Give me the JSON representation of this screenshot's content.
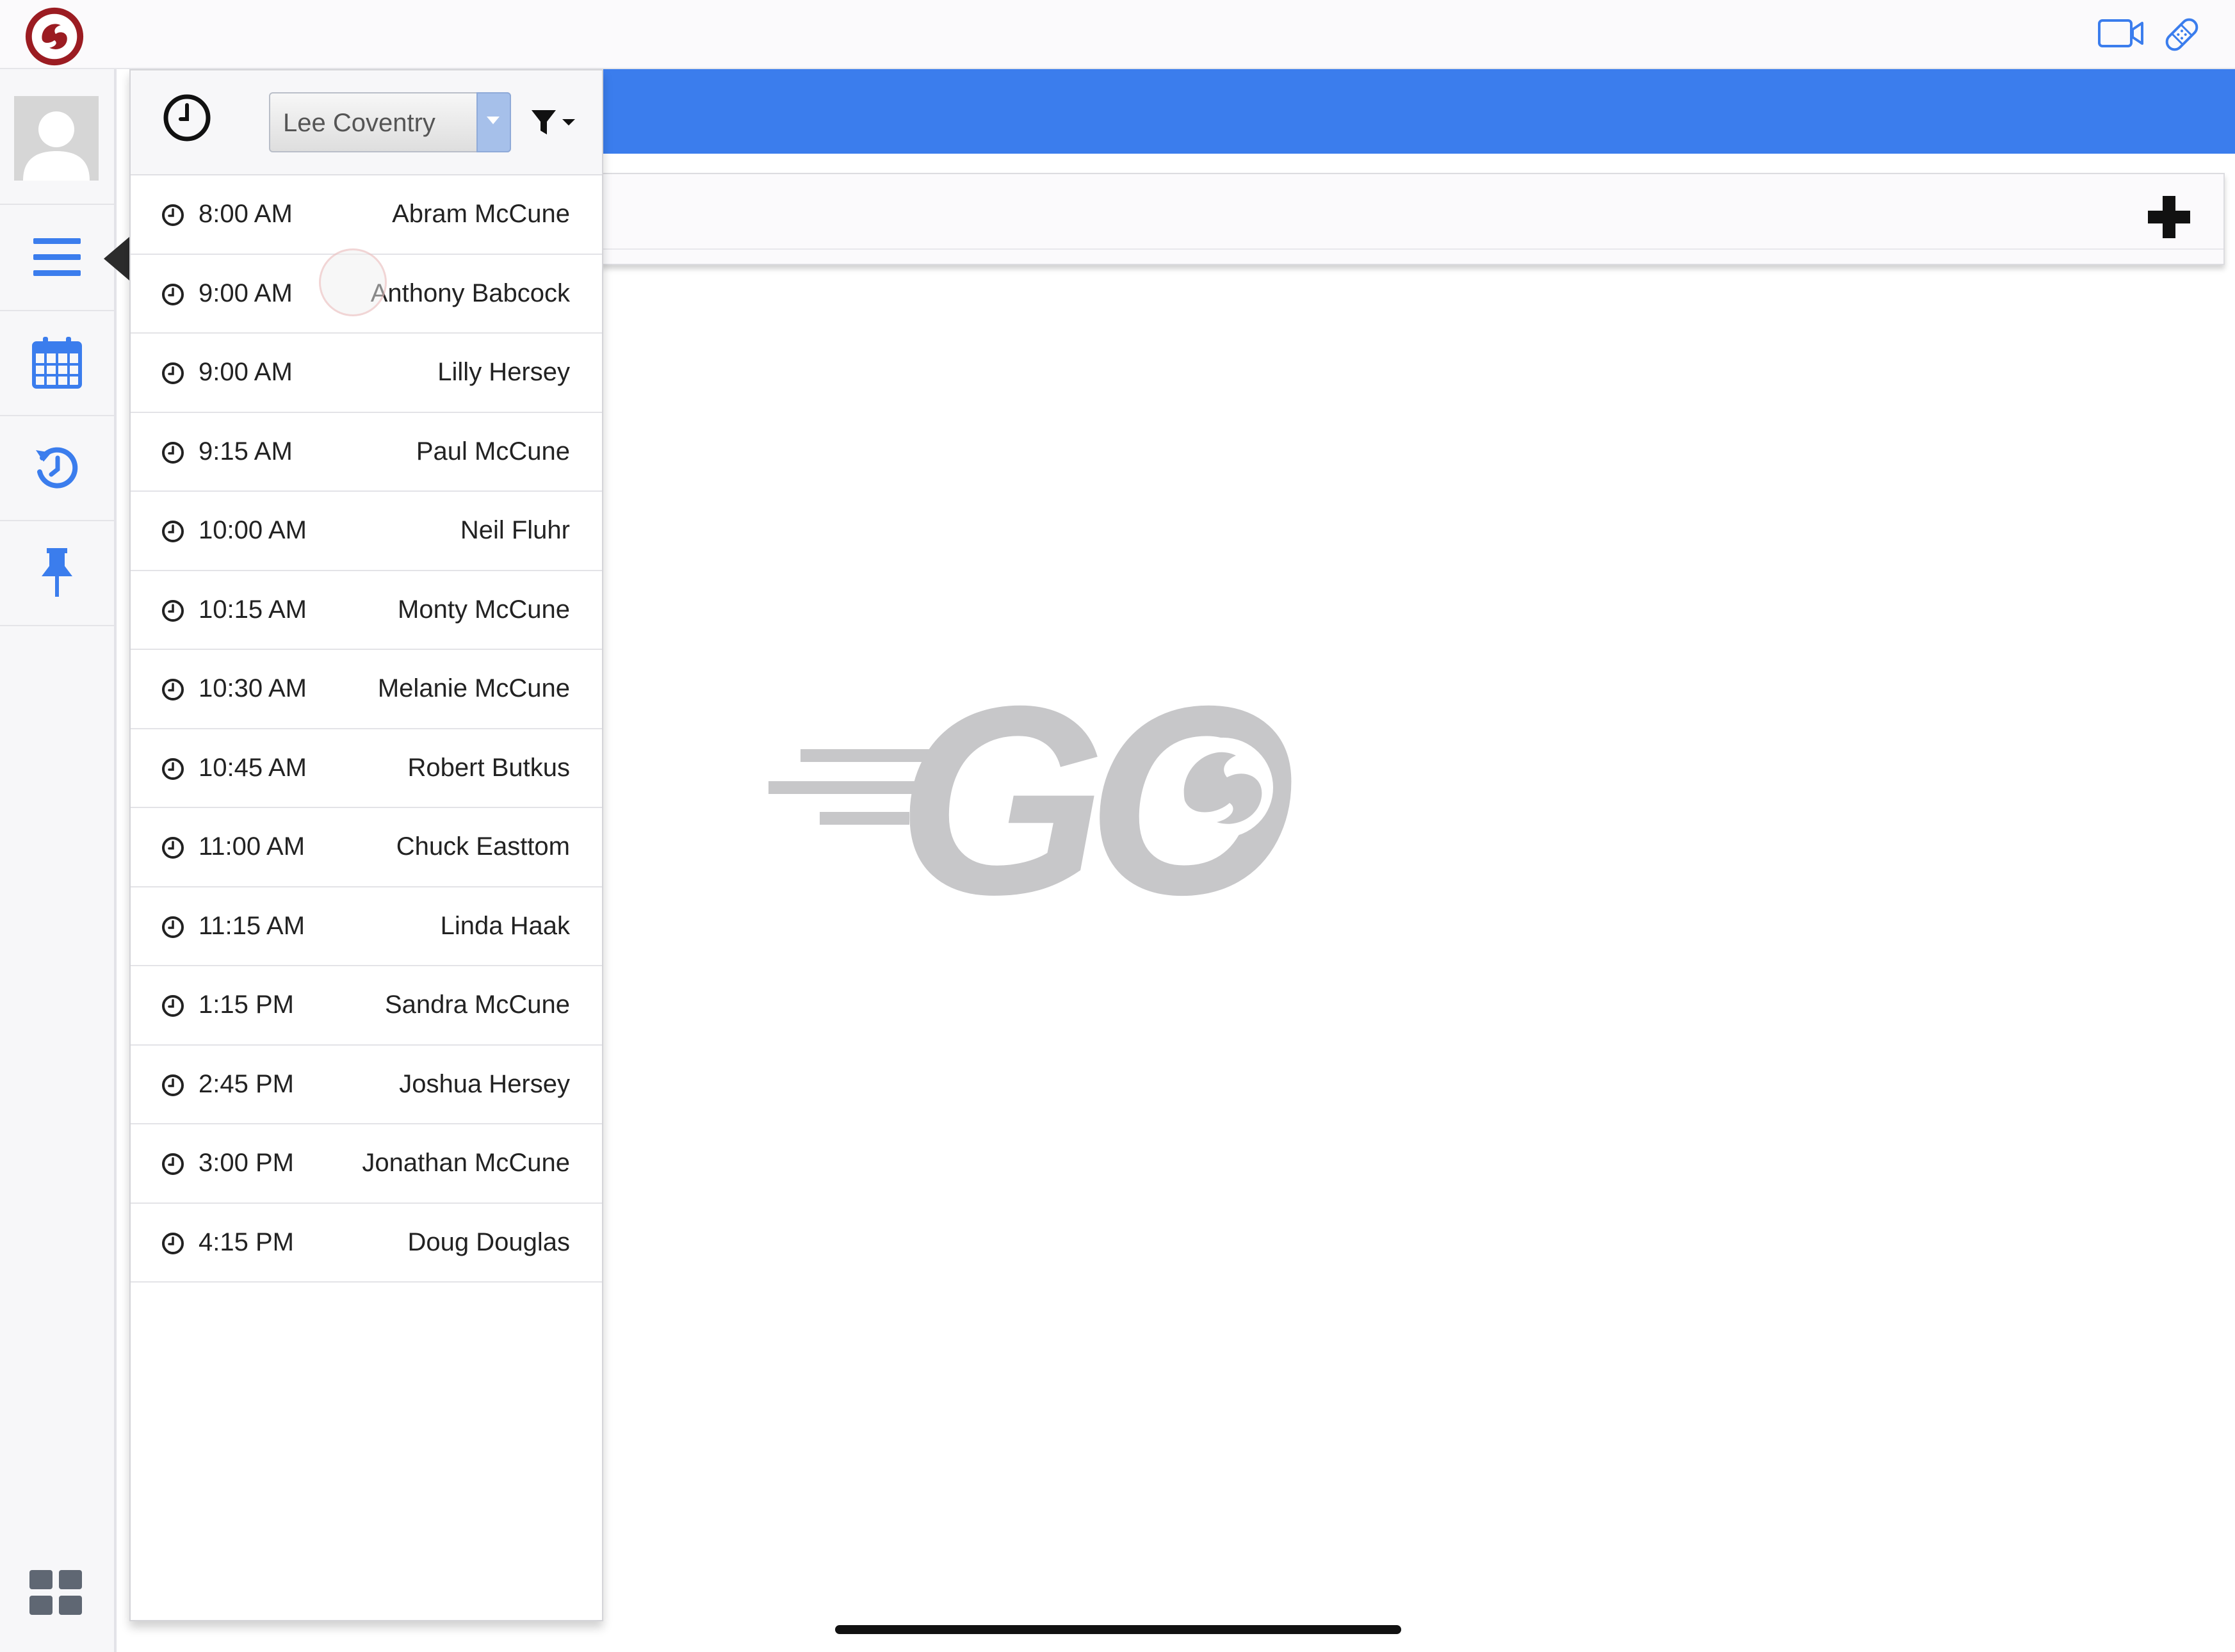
{
  "colors": {
    "accent_blue": "#3b7ded",
    "logo_red": "#9b1c22",
    "watermark_gray": "#c7c7c9"
  },
  "top_bar": {
    "icons": [
      "app-logo",
      "video-icon",
      "bandage-icon"
    ]
  },
  "sidebar": {
    "items": [
      "avatar",
      "menu-icon",
      "calendar-icon",
      "history-icon",
      "pin-icon",
      "grid-icon"
    ]
  },
  "schedule_panel": {
    "provider_select": {
      "value": "Lee Coventry"
    },
    "appointments": [
      {
        "time": "8:00 AM",
        "name": "Abram McCune"
      },
      {
        "time": "9:00 AM",
        "name": "Anthony Babcock"
      },
      {
        "time": "9:00 AM",
        "name": "Lilly Hersey"
      },
      {
        "time": "9:15 AM",
        "name": "Paul McCune"
      },
      {
        "time": "10:00 AM",
        "name": "Neil Fluhr"
      },
      {
        "time": "10:15 AM",
        "name": "Monty McCune"
      },
      {
        "time": "10:30 AM",
        "name": "Melanie McCune"
      },
      {
        "time": "10:45 AM",
        "name": "Robert Butkus"
      },
      {
        "time": "11:00 AM",
        "name": "Chuck Easttom"
      },
      {
        "time": "11:15 AM",
        "name": "Linda Haak"
      },
      {
        "time": "1:15 PM",
        "name": "Sandra McCune"
      },
      {
        "time": "2:45 PM",
        "name": "Joshua Hersey"
      },
      {
        "time": "3:00 PM",
        "name": "Jonathan McCune"
      },
      {
        "time": "4:15 PM",
        "name": "Doug Douglas"
      }
    ]
  },
  "main": {
    "watermark_text": "GO"
  }
}
